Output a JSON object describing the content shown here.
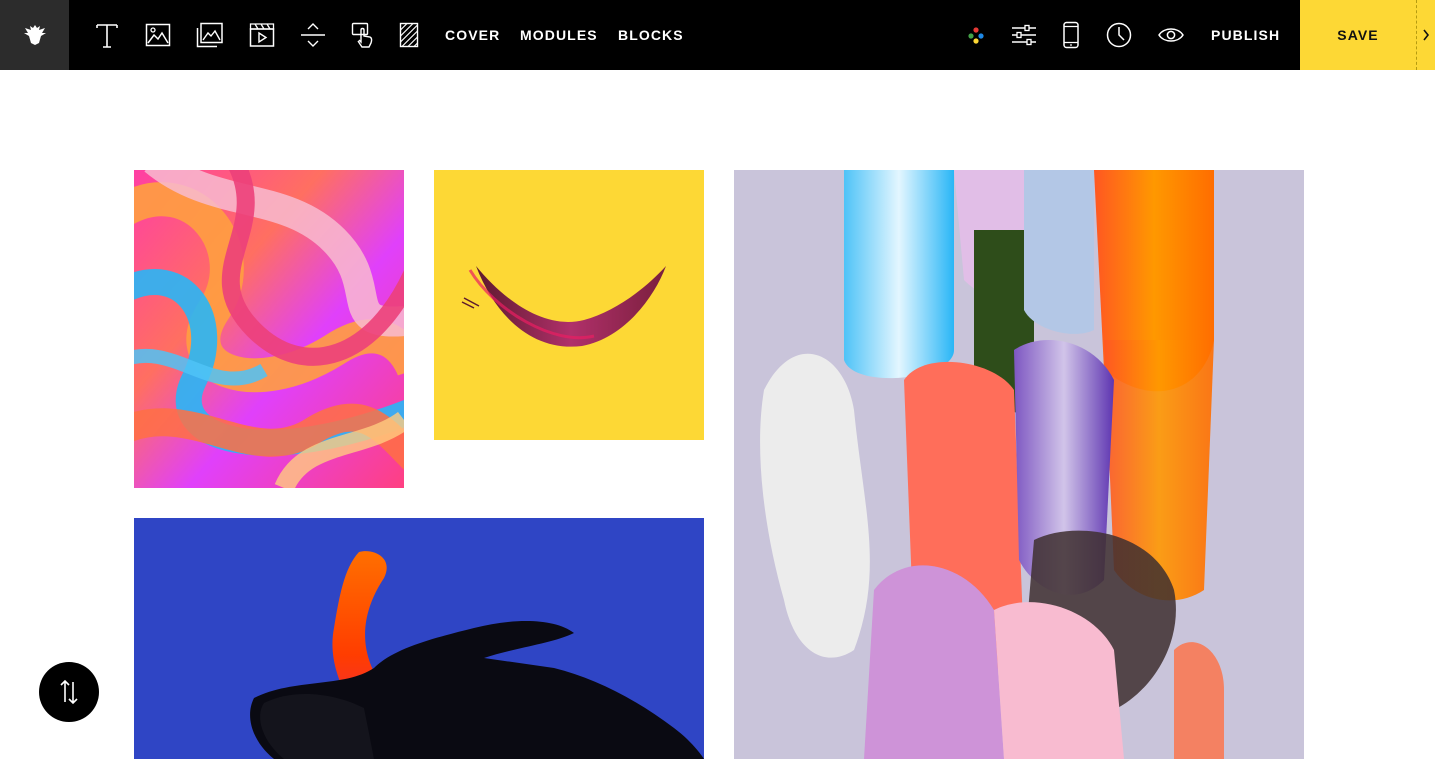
{
  "toolbar": {
    "logo_icon": "eagle-logo-icon",
    "tools": [
      {
        "name": "text-tool-icon"
      },
      {
        "name": "image-tool-icon"
      },
      {
        "name": "image-grid-tool-icon"
      },
      {
        "name": "video-tool-icon"
      },
      {
        "name": "spacing-tool-icon"
      },
      {
        "name": "interaction-tool-icon"
      },
      {
        "name": "pattern-tool-icon"
      }
    ],
    "cover_label": "COVER",
    "modules_label": "MODULES",
    "blocks_label": "BLOCKS",
    "right_icons": [
      "color-palette-icon",
      "settings-sliders-icon",
      "mobile-preview-icon",
      "history-clock-icon",
      "preview-eye-icon"
    ],
    "publish_label": "PUBLISH",
    "save_label": "SAVE",
    "save_arrow_icon": "chevron-right-icon",
    "accent_color": "#fdd835"
  },
  "canvas": {
    "images": [
      {
        "name": "pink-swirl-paint-image"
      },
      {
        "name": "yellow-brushstroke-image"
      },
      {
        "name": "paint-smears-image"
      },
      {
        "name": "blue-hand-paint-image"
      }
    ],
    "reorder_icon": "reorder-arrows-icon"
  }
}
